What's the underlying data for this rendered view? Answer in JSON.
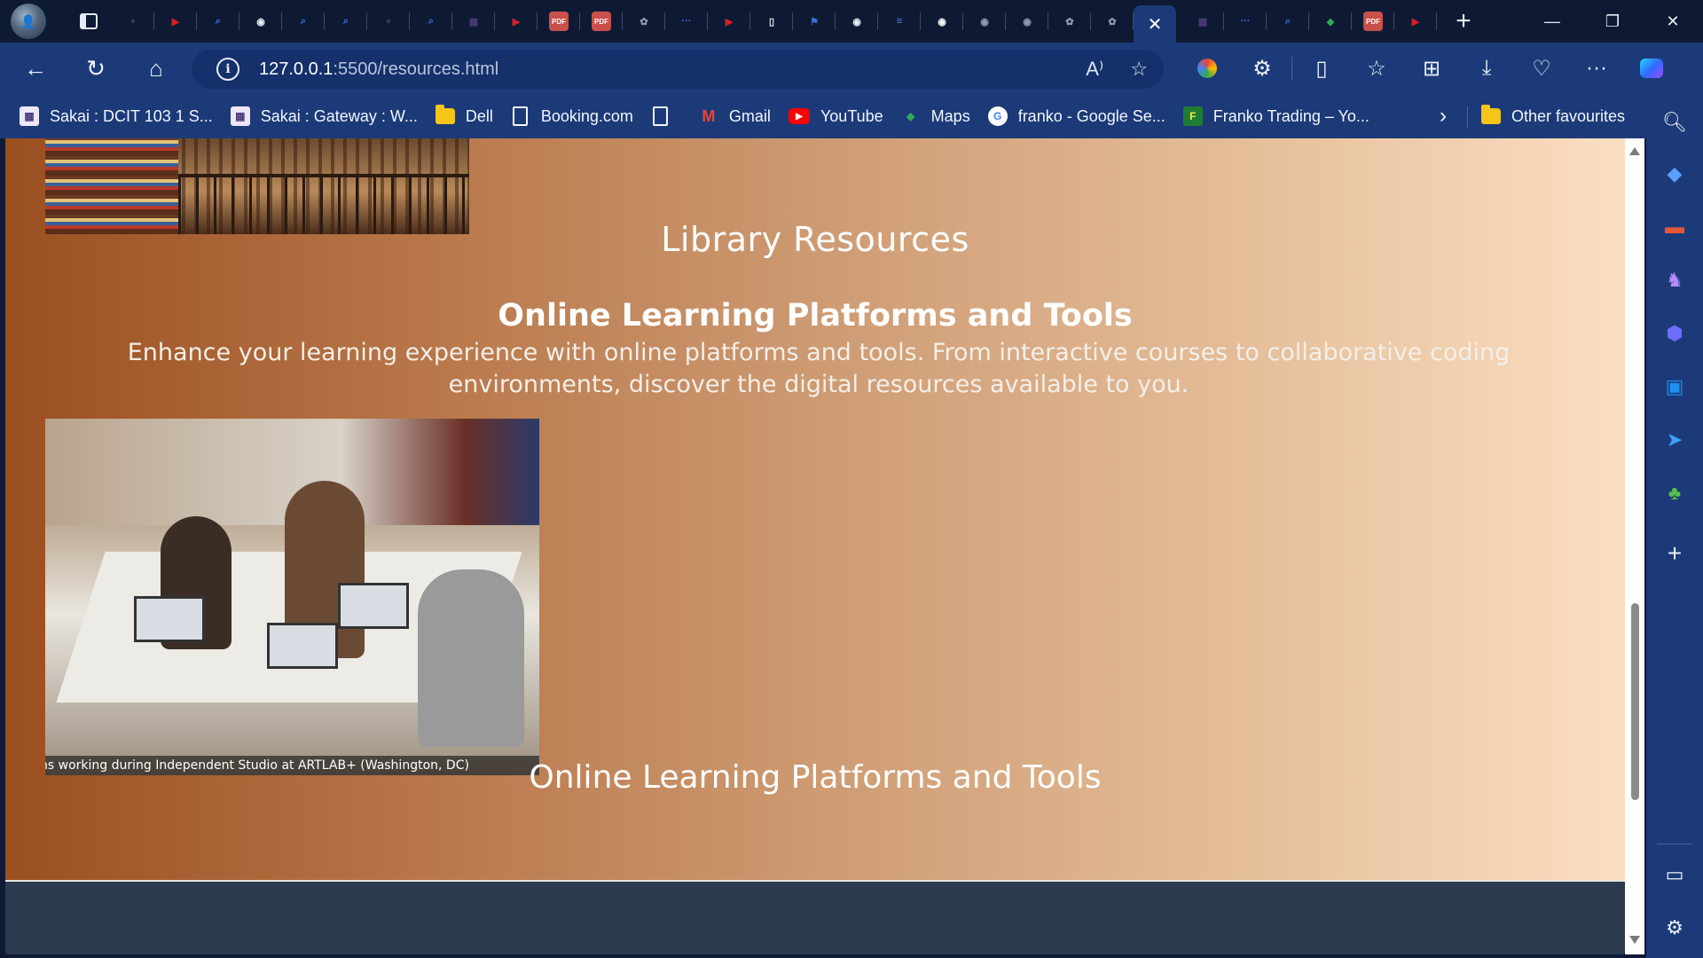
{
  "browser": {
    "tabs": [
      {
        "icon": "user-icon"
      },
      {
        "icon": "tab-window-icon"
      },
      {
        "icon": "globe-icon",
        "color": "#2a3b5a"
      },
      {
        "icon": "youtube-icon",
        "color": "#d61f26"
      },
      {
        "icon": "search-icon",
        "color": "#3b74d8"
      },
      {
        "icon": "github-icon",
        "color": "#e6ecf5"
      },
      {
        "icon": "search-icon",
        "color": "#3b74d8"
      },
      {
        "icon": "search-icon",
        "color": "#3b74d8"
      },
      {
        "icon": "globe-icon",
        "color": "#2a3b5a"
      },
      {
        "icon": "search-icon",
        "color": "#3b74d8"
      },
      {
        "icon": "sakai-icon",
        "color": "#4b3a7a"
      },
      {
        "icon": "youtube-icon",
        "color": "#d61f26"
      },
      {
        "icon": "pdf-icon",
        "color": "#c9504a"
      },
      {
        "icon": "pdf-icon",
        "color": "#c9504a"
      },
      {
        "icon": "openai-icon",
        "color": "#8fa0b4"
      },
      {
        "icon": "dots-icon",
        "color": "#3b74d8"
      },
      {
        "icon": "youtube-icon",
        "color": "#d61f26"
      },
      {
        "icon": "document-icon",
        "color": "#e6ecf5"
      },
      {
        "icon": "flag-icon",
        "color": "#3b74d8"
      },
      {
        "icon": "github-icon",
        "color": "#e6ecf5"
      },
      {
        "icon": "docs-icon",
        "color": "#4a86e8"
      },
      {
        "icon": "github-icon",
        "color": "#ffffff"
      },
      {
        "icon": "github-icon",
        "color": "#8fa0b4"
      },
      {
        "icon": "github-icon",
        "color": "#8fa0b4"
      },
      {
        "icon": "openai-icon",
        "color": "#8fa0b4"
      },
      {
        "icon": "openai-icon",
        "color": "#8fa0b4"
      }
    ],
    "active_tab_close": "✕",
    "tabs_after": [
      {
        "icon": "sakai-icon",
        "color": "#4b3a7a"
      },
      {
        "icon": "dots-icon",
        "color": "#3b74d8"
      },
      {
        "icon": "search-icon",
        "color": "#3b74d8"
      },
      {
        "icon": "maps-icon",
        "color": "#34a853"
      },
      {
        "icon": "pdf-icon",
        "color": "#c9504a"
      },
      {
        "icon": "youtube-icon",
        "color": "#d61f26"
      }
    ],
    "new_tab_label": "+",
    "address": {
      "host": "127.0.0.1",
      "path": ":5500/resources.html",
      "info_glyph": "i"
    },
    "bookmarks": [
      {
        "label": "Sakai : DCIT 103 1 S...",
        "icon": "sakai-icon",
        "color": "#4b3a7a"
      },
      {
        "label": "Sakai : Gateway : W...",
        "icon": "sakai-icon",
        "color": "#4b3a7a"
      },
      {
        "label": "Dell",
        "icon": "folder-icon",
        "color": "#f5c518"
      },
      {
        "label": "Booking.com",
        "icon": "document-icon",
        "color": "#f2f6fc"
      },
      {
        "label": "",
        "icon": "document-icon",
        "color": "#f2f6fc"
      },
      {
        "label": "Gmail",
        "icon": "gmail-icon",
        "color": "#ea4335"
      },
      {
        "label": "YouTube",
        "icon": "youtube-icon",
        "color": "#ff0000"
      },
      {
        "label": "Maps",
        "icon": "maps-icon",
        "color": "#34a853"
      },
      {
        "label": "franko - Google Se...",
        "icon": "google-icon",
        "color": "#ffffff"
      },
      {
        "label": "Franko Trading – Yo...",
        "icon": "franko-icon",
        "color": "#1e7d32"
      }
    ],
    "other_favourites": "Other favourites"
  },
  "page": {
    "library_heading": "Library Resources",
    "platforms_heading": "Online Learning Platforms and Tools",
    "intro_text": "Enhance your learning experience with online platforms and tools. From interactive courses to collaborative coding environments, discover the digital resources available to you.",
    "image_caption": "ns working during Independent Studio at ARTLAB+ (Washington, DC)",
    "bottom_heading": "Online Learning Platforms and Tools",
    "gradient_start": "#9b4f20",
    "gradient_end": "#fbdec1",
    "footer_color": "#2b3a4f"
  }
}
